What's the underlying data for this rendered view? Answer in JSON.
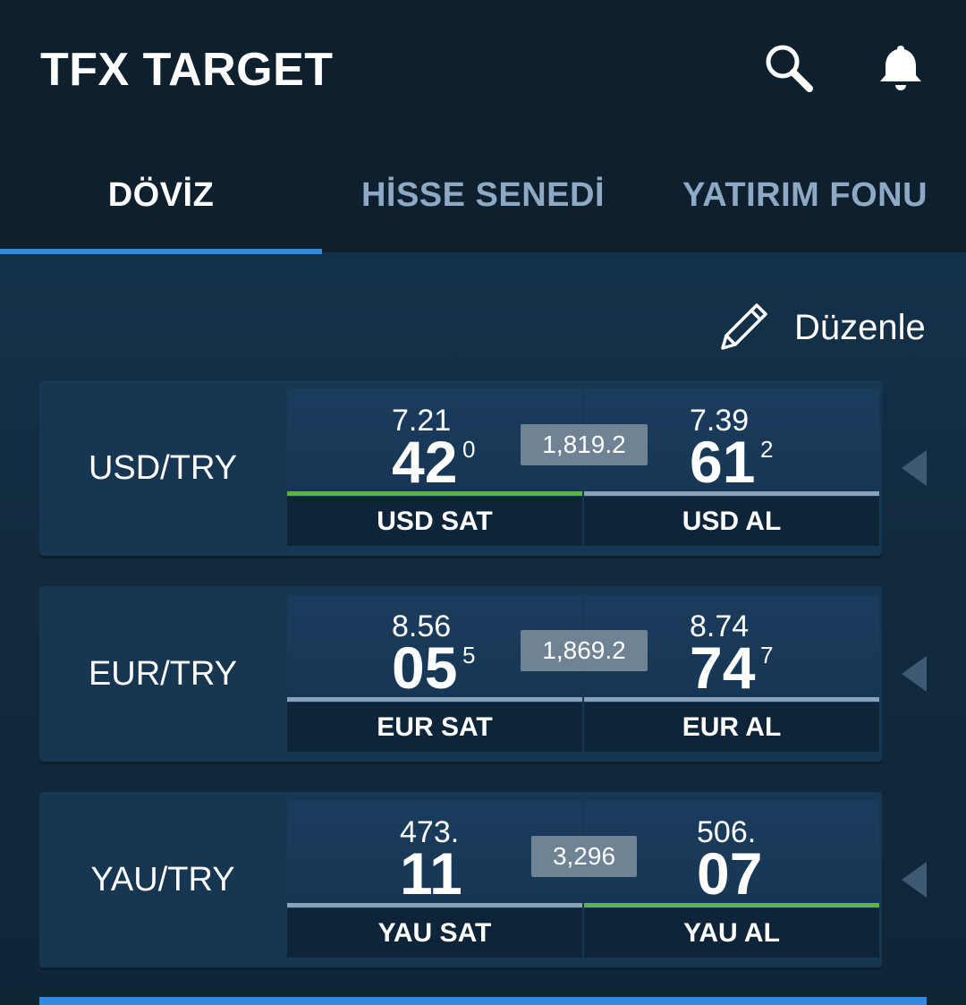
{
  "app": {
    "title": "TFX TARGET"
  },
  "icons": {
    "search": "search-icon",
    "bell": "bell-icon",
    "edit": "pencil-icon",
    "expand": "triangle-left-icon"
  },
  "tabs": [
    {
      "label": "DÖVİZ",
      "active": true
    },
    {
      "label": "HİSSE SENEDİ",
      "active": false
    },
    {
      "label": "YATIRIM FONU",
      "active": false
    }
  ],
  "edit_label": "Düzenle",
  "colors": {
    "accent": "#2f8be0",
    "up": "#5cb341",
    "neutral": "#8aa2b8"
  },
  "quotes": [
    {
      "pair": "USD/TRY",
      "spread": "1,819.2",
      "sell": {
        "prefix": "7.21",
        "big": "42",
        "sup": "0",
        "label": "USD SAT",
        "trend": "up"
      },
      "buy": {
        "prefix": "7.39",
        "big": "61",
        "sup": "2",
        "label": "USD AL",
        "trend": "neutral"
      }
    },
    {
      "pair": "EUR/TRY",
      "spread": "1,869.2",
      "sell": {
        "prefix": "8.56",
        "big": "05",
        "sup": "5",
        "label": "EUR SAT",
        "trend": "neutral"
      },
      "buy": {
        "prefix": "8.74",
        "big": "74",
        "sup": "7",
        "label": "EUR AL",
        "trend": "neutral"
      }
    },
    {
      "pair": "YAU/TRY",
      "spread": "3,296",
      "sell": {
        "prefix": "473.",
        "big": "11",
        "sup": "",
        "label": "YAU SAT",
        "trend": "neutral"
      },
      "buy": {
        "prefix": "506.",
        "big": "07",
        "sup": "",
        "label": "YAU AL",
        "trend": "up"
      }
    }
  ]
}
